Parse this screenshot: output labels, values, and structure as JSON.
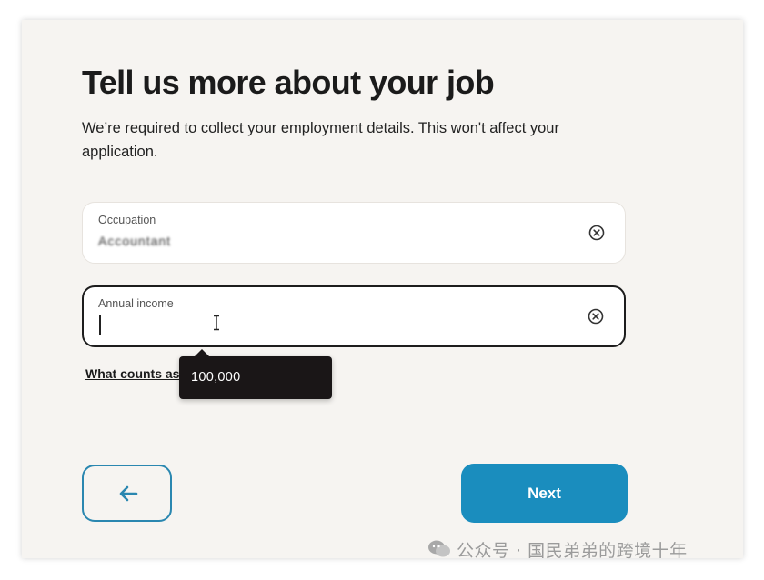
{
  "page": {
    "title": "Tell us more about your job",
    "subtitle": "We’re required to collect your employment details. This won't affect your application."
  },
  "occupation": {
    "label": "Occupation",
    "value_obscured": "Accountant"
  },
  "income": {
    "label": "Annual income",
    "value": ""
  },
  "help_link": {
    "label": "What counts as"
  },
  "tooltip": {
    "text": "100,000"
  },
  "buttons": {
    "back_icon": "arrow-left-icon",
    "next_label": "Next"
  },
  "watermark": {
    "text": "公众号 · 国民弟弟的跨境十年",
    "icon": "wechat-icon"
  },
  "colors": {
    "accent": "#1a8dbe",
    "outline": "#2a87b0",
    "background": "#f6f4f1",
    "tooltip": "#1a1617"
  }
}
